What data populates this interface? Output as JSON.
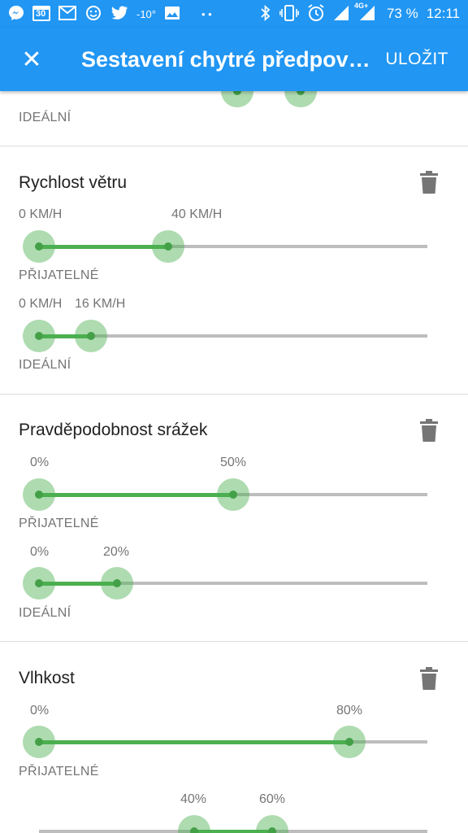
{
  "status_bar": {
    "notification_icons": [
      "messenger-icon",
      "calendar-icon",
      "gmail-icon",
      "weather-icon",
      "twitter-icon"
    ],
    "calendar_day": "30",
    "temperature": "-10°",
    "dots": "• •",
    "network": "4G+",
    "battery": "73 %",
    "time": "12:11"
  },
  "app_bar": {
    "title": "Sestavení chytré předpově…",
    "save_label": "ULOŽIT",
    "close_label": "✕"
  },
  "sections": {
    "top": {
      "ideal_caption": "IDEÁLNÍ"
    },
    "wind": {
      "title": "Rychlost větru",
      "acceptable": {
        "min_label": "0 KM/H",
        "max_label": "40 KM/H",
        "min": 0,
        "max": 40,
        "caption": "PŘIJATELNÉ"
      },
      "ideal": {
        "min_label": "0 KM/H",
        "max_label": "16 KM/H",
        "min": 0,
        "max": 16,
        "caption": "IDEÁLNÍ"
      }
    },
    "precipitation": {
      "title": "Pravděpodobnost srážek",
      "acceptable": {
        "min_label": "0%",
        "max_label": "50%",
        "min": 0,
        "max": 50,
        "caption": "PŘIJATELNÉ"
      },
      "ideal": {
        "min_label": "0%",
        "max_label": "20%",
        "min": 0,
        "max": 20,
        "caption": "IDEÁLNÍ"
      }
    },
    "humidity": {
      "title": "Vlhkost",
      "acceptable": {
        "min_label": "0%",
        "max_label": "80%",
        "min": 0,
        "max": 80,
        "caption": "PŘIJATELNÉ"
      },
      "ideal": {
        "min_label": "40%",
        "max_label": "60%",
        "min": 40,
        "max": 60
      }
    }
  },
  "colors": {
    "primary": "#2196f3",
    "slider_active": "#4caf50",
    "slider_inactive": "#bdbdbd"
  }
}
